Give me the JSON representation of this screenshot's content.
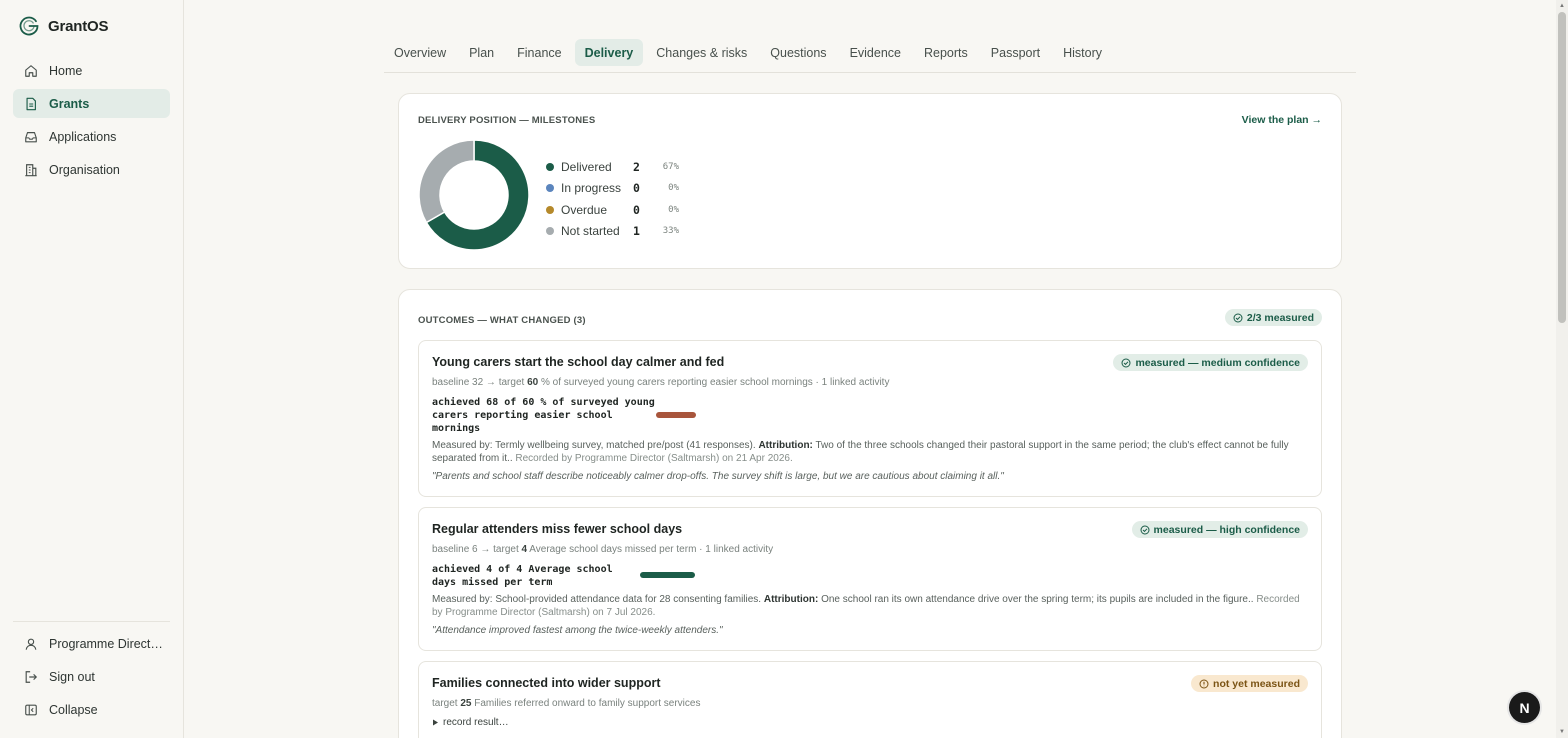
{
  "brand": {
    "name": "GrantOS"
  },
  "colors": {
    "accent": "#1b5c48",
    "delivered": "#1b5c48",
    "in_progress": "#5b85bd",
    "overdue": "#b5892b",
    "not_started": "#a6acaf",
    "bar_first": "#a8553c",
    "bar_second": "#1b5c48"
  },
  "sidebar": {
    "items": [
      {
        "label": "Home",
        "icon": "home-icon"
      },
      {
        "label": "Grants",
        "icon": "document-icon"
      },
      {
        "label": "Applications",
        "icon": "inbox-icon"
      },
      {
        "label": "Organisation",
        "icon": "building-icon"
      }
    ],
    "bottom": [
      {
        "label": "Programme Direct…",
        "icon": "user-icon"
      },
      {
        "label": "Sign out",
        "icon": "sign-out-icon"
      },
      {
        "label": "Collapse",
        "icon": "collapse-icon"
      }
    ]
  },
  "tabs": [
    "Overview",
    "Plan",
    "Finance",
    "Delivery",
    "Changes & risks",
    "Questions",
    "Evidence",
    "Reports",
    "Passport",
    "History"
  ],
  "delivery": {
    "title": "DELIVERY POSITION — MILESTONES",
    "link": "View the plan →",
    "legend": [
      {
        "label": "Delivered",
        "count": "2",
        "pct": "67%"
      },
      {
        "label": "In progress",
        "count": "0",
        "pct": "0%"
      },
      {
        "label": "Overdue",
        "count": "0",
        "pct": "0%"
      },
      {
        "label": "Not started",
        "count": "1",
        "pct": "33%"
      }
    ],
    "donut": {
      "delivered": 2,
      "in_progress": 0,
      "overdue": 0,
      "not_started": 1
    }
  },
  "outcomes": {
    "title": "OUTCOMES — WHAT CHANGED (3)",
    "badge": "2/3 measured",
    "items": [
      {
        "title": "Young carers start the school day calmer and fed",
        "status": "measured — medium confidence",
        "meta_pre": "baseline 32 → target ",
        "meta_target": "60",
        "meta_post": " % of surveyed young carers reporting easier school mornings · 1 linked activity",
        "achieved": [
          "achieved 68 of 60 % of surveyed young",
          "carers reporting easier school",
          "mornings"
        ],
        "progress": 1.0,
        "measured_by": "Measured by: Termly wellbeing survey, matched pre/post (41 responses). ",
        "attribution_label": "Attribution:",
        "attribution": " Two of the three schools changed their pastoral support in the same period; the club's effect cannot be fully separated from it.. ",
        "recorded": "Recorded by Programme Director (Saltmarsh) on 21 Apr 2026.",
        "quote": "\"Parents and school staff describe noticeably calmer drop-offs. The survey shift is large, but we are cautious about claiming it all.\""
      },
      {
        "title": "Regular attenders miss fewer school days",
        "status": "measured — high confidence",
        "meta_pre": "baseline 6 → target ",
        "meta_target": "4",
        "meta_post": " Average school days missed per term · 1 linked activity",
        "achieved": [
          "achieved 4 of 4 Average school",
          "days missed per term"
        ],
        "progress": 1.0,
        "measured_by": "Measured by: School-provided attendance data for 28 consenting families. ",
        "attribution_label": "Attribution:",
        "attribution": " One school ran its own attendance drive over the spring term; its pupils are included in the figure.. ",
        "recorded": "Recorded by Programme Director (Saltmarsh) on 7 Jul 2026.",
        "quote": "\"Attendance improved fastest among the twice-weekly attenders.\""
      },
      {
        "title": "Families connected into wider support",
        "status": "not yet measured",
        "meta_pre": "target ",
        "meta_target": "25",
        "meta_post": " Families referred onward to family support services",
        "record": "record result…"
      }
    ]
  },
  "floating": {
    "label": "N"
  }
}
